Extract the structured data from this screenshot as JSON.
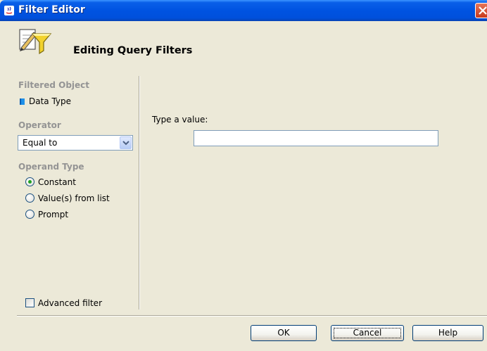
{
  "window": {
    "title": "Filter Editor"
  },
  "header": {
    "title": "Editing Query Filters",
    "icon": "filter-edit-icon"
  },
  "left_panel": {
    "filtered_object_label": "Filtered Object",
    "filtered_object_value": "Data Type",
    "operator_label": "Operator",
    "operator_value": "Equal to",
    "operand_type_label": "Operand Type",
    "operand_options": [
      {
        "label": "Constant",
        "selected": true
      },
      {
        "label": "Value(s) from list",
        "selected": false
      },
      {
        "label": "Prompt",
        "selected": false
      }
    ],
    "advanced_filter_label": "Advanced filter",
    "advanced_filter_checked": false
  },
  "right_panel": {
    "type_value_label": "Type a value:",
    "value": ""
  },
  "buttons": {
    "ok": "OK",
    "cancel": "Cancel",
    "help": "Help"
  },
  "colors": {
    "titlebar": "#0053E1",
    "dialog_bg": "#ECE9D8",
    "section_label": "#949494",
    "close_button": "#C8391C"
  }
}
